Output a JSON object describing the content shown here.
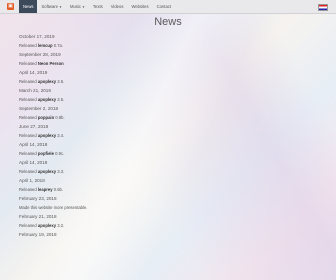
{
  "navbar": {
    "logo_glyph": "▣",
    "items": [
      {
        "label": "News",
        "active": true,
        "dropdown": false
      },
      {
        "label": "Software",
        "active": false,
        "dropdown": true
      },
      {
        "label": "Music",
        "active": false,
        "dropdown": true
      },
      {
        "label": "Texts",
        "active": false,
        "dropdown": false
      },
      {
        "label": "Videos",
        "active": false,
        "dropdown": false
      },
      {
        "label": "Websites",
        "active": false,
        "dropdown": false
      },
      {
        "label": "Contact",
        "active": false,
        "dropdown": false
      }
    ],
    "flag_icon": "uk-flag-icon"
  },
  "page": {
    "title": "News"
  },
  "news": [
    {
      "date": "October 17, 2019",
      "prefix": "Released",
      "name": "lemcup",
      "suffix": "0.7a."
    },
    {
      "date": "September 28, 2019",
      "prefix": "Released",
      "name": "Neon Person",
      "suffix": ""
    },
    {
      "date": "April 14, 2019",
      "prefix": "Released",
      "name": "apoplexy",
      "suffix": "3.6."
    },
    {
      "date": "March 21, 2019",
      "prefix": "Released",
      "name": "apoplexy",
      "suffix": "3.5."
    },
    {
      "date": "September 2, 2018",
      "prefix": "Released",
      "name": "poppain",
      "suffix": "0.9b."
    },
    {
      "date": "June 27, 2018",
      "prefix": "Released",
      "name": "apoplexy",
      "suffix": "3.4."
    },
    {
      "date": "April 14, 2018",
      "prefix": "Released",
      "name": "popfiele",
      "suffix": "0.9c."
    },
    {
      "date": "April 14, 2018",
      "prefix": "Released",
      "name": "apoplexy",
      "suffix": "3.3."
    },
    {
      "date": "April 1, 2018",
      "prefix": "Released",
      "name": "leaprey",
      "suffix": "0.5b."
    },
    {
      "date": "February 23, 2018",
      "prefix": "Made this website more presentable.",
      "name": "",
      "suffix": ""
    },
    {
      "date": "February 21, 2018",
      "prefix": "Released",
      "name": "apoplexy",
      "suffix": "3.2."
    },
    {
      "date": "February 19, 2018",
      "prefix": "",
      "name": "",
      "suffix": ""
    }
  ]
}
